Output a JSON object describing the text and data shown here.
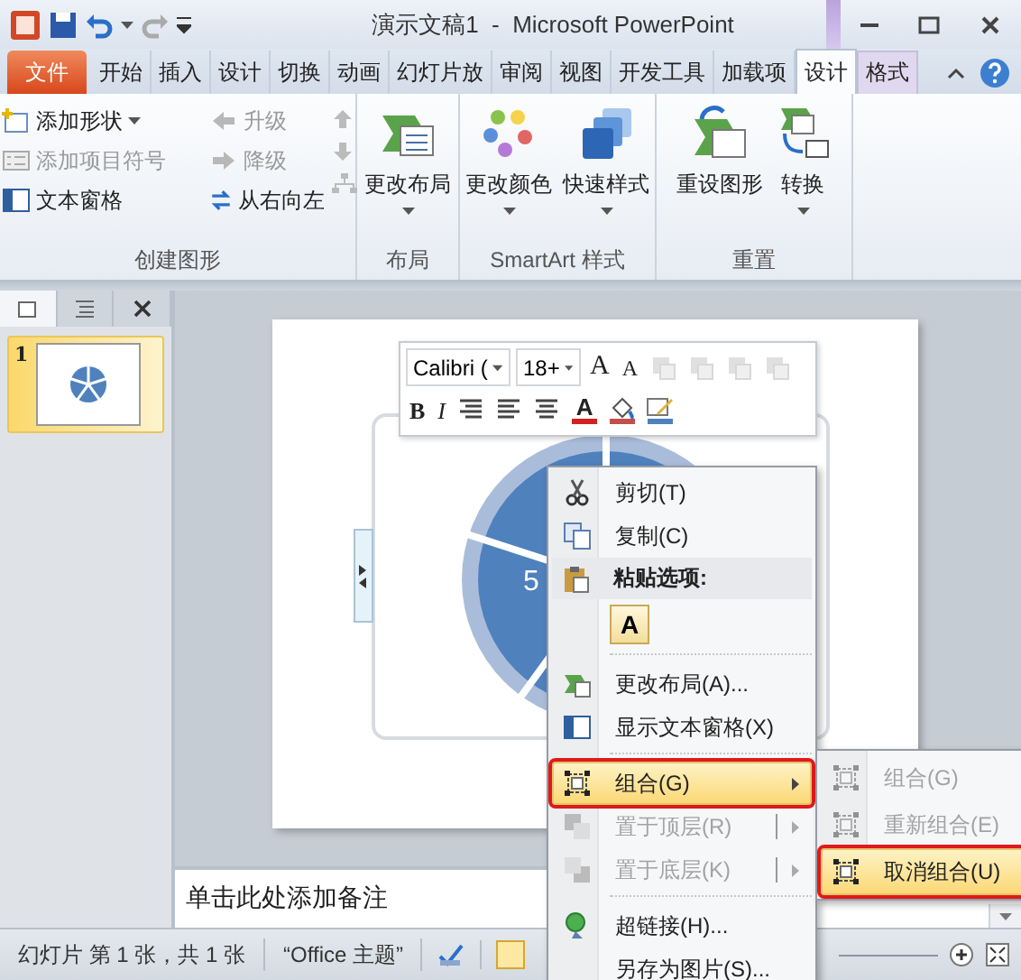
{
  "window": {
    "title": "演示文稿1  -  Microsoft PowerPoint"
  },
  "tabs": [
    {
      "label": "文件",
      "kind": "file",
      "selected": false
    },
    {
      "label": "开始",
      "kind": "main",
      "selected": false
    },
    {
      "label": "插入",
      "kind": "main",
      "selected": false
    },
    {
      "label": "设计",
      "kind": "main",
      "selected": false
    },
    {
      "label": "切换",
      "kind": "main",
      "selected": false
    },
    {
      "label": "动画",
      "kind": "main",
      "selected": false
    },
    {
      "label": "幻灯片放",
      "kind": "main",
      "selected": false
    },
    {
      "label": "审阅",
      "kind": "main",
      "selected": false
    },
    {
      "label": "视图",
      "kind": "main",
      "selected": false
    },
    {
      "label": "开发工具",
      "kind": "main",
      "selected": false
    },
    {
      "label": "加载项",
      "kind": "main",
      "selected": false
    },
    {
      "label": "设计",
      "kind": "contextual",
      "selected": true
    },
    {
      "label": "格式",
      "kind": "contextual",
      "selected": false
    }
  ],
  "ribbon": [
    {
      "label": "创建图形",
      "kind": "small",
      "items": [
        {
          "label": "添加形状",
          "disabled": false,
          "dropdown": true
        },
        {
          "label": "添加项目符号",
          "disabled": true,
          "dropdown": false
        },
        {
          "label": "文本窗格",
          "disabled": false,
          "dropdown": false
        },
        {
          "label": "升级",
          "disabled": true,
          "dropdown": false
        },
        {
          "label": "降级",
          "disabled": true,
          "dropdown": false
        },
        {
          "label": "从右向左",
          "disabled": false,
          "dropdown": false
        }
      ]
    },
    {
      "label": "布局",
      "kind": "large",
      "items": [
        {
          "label": "更改布局",
          "disabled": false,
          "dropdown": true
        }
      ]
    },
    {
      "label": "SmartArt 样式",
      "kind": "large",
      "items": [
        {
          "label": "更改颜色",
          "disabled": false,
          "dropdown": true
        },
        {
          "label": "快速样式",
          "disabled": false,
          "dropdown": true
        }
      ]
    },
    {
      "label": "重置",
      "kind": "large",
      "items": [
        {
          "label": "重设图形",
          "disabled": false,
          "dropdown": false
        },
        {
          "label": "转换",
          "disabled": false,
          "dropdown": true
        }
      ]
    }
  ],
  "slides_pane": {
    "thumbnails": [
      {
        "number": "1",
        "selected": true
      }
    ]
  },
  "mini_toolbar": {
    "top_row": [
      {
        "kind": "font",
        "label": "Calibri ("
      },
      {
        "kind": "size",
        "label": "18+"
      },
      {
        "kind": "grow",
        "label": "A"
      },
      {
        "kind": "shrink",
        "label": "A"
      },
      {
        "kind": "arrange",
        "disabled": true
      },
      {
        "kind": "arrange",
        "disabled": true
      },
      {
        "kind": "arrange",
        "disabled": true
      },
      {
        "kind": "arrange",
        "disabled": true
      }
    ],
    "bottom_row": [
      {
        "kind": "bold",
        "label": "B"
      },
      {
        "kind": "italic",
        "label": "I"
      },
      {
        "kind": "align"
      },
      {
        "kind": "align"
      },
      {
        "kind": "align"
      },
      {
        "kind": "color",
        "label": "A"
      },
      {
        "kind": "fill"
      },
      {
        "kind": "outline"
      }
    ]
  },
  "slide": {
    "smartart_label": "5"
  },
  "notes": {
    "prompt": "单击此处添加备注"
  },
  "status_bar": {
    "items": [
      "幻灯片 第 1 张，共 1 张",
      "“Office 主题”"
    ]
  },
  "context_menu": {
    "items": [
      {
        "kind": "item",
        "label": "剪切(T)",
        "disabled": false,
        "highlighted": false,
        "submenu": false,
        "marked": false
      },
      {
        "kind": "item",
        "label": "复制(C)",
        "disabled": false,
        "highlighted": false,
        "submenu": false,
        "marked": false
      },
      {
        "kind": "header",
        "label": "粘贴选项:"
      },
      {
        "kind": "paste",
        "label": "A"
      },
      {
        "kind": "separator"
      },
      {
        "kind": "item",
        "label": "更改布局(A)...",
        "disabled": false,
        "highlighted": false,
        "submenu": false,
        "marked": false
      },
      {
        "kind": "item",
        "label": "显示文本窗格(X)",
        "disabled": false,
        "highlighted": false,
        "submenu": false,
        "marked": false
      },
      {
        "kind": "separator"
      },
      {
        "kind": "item",
        "label": "组合(G)",
        "disabled": false,
        "highlighted": true,
        "submenu": true,
        "marked": true
      },
      {
        "kind": "item",
        "label": "置于顶层(R)",
        "disabled": true,
        "highlighted": false,
        "submenu": true,
        "marked": false
      },
      {
        "kind": "item",
        "label": "置于底层(K)",
        "disabled": true,
        "highlighted": false,
        "submenu": true,
        "marked": false
      },
      {
        "kind": "separator"
      },
      {
        "kind": "item",
        "label": "超链接(H)...",
        "disabled": false,
        "highlighted": false,
        "submenu": false,
        "marked": false
      },
      {
        "kind": "item",
        "label": "另存为图片(S)...",
        "disabled": false,
        "highlighted": false,
        "submenu": false,
        "marked": false
      }
    ]
  },
  "submenu": {
    "items": [
      {
        "label": "组合(G)",
        "disabled": true,
        "highlighted": false,
        "marked": false
      },
      {
        "label": "重新组合(E)",
        "disabled": true,
        "highlighted": false,
        "marked": false
      },
      {
        "label": "取消组合(U)",
        "disabled": false,
        "highlighted": true,
        "marked": true
      }
    ]
  }
}
